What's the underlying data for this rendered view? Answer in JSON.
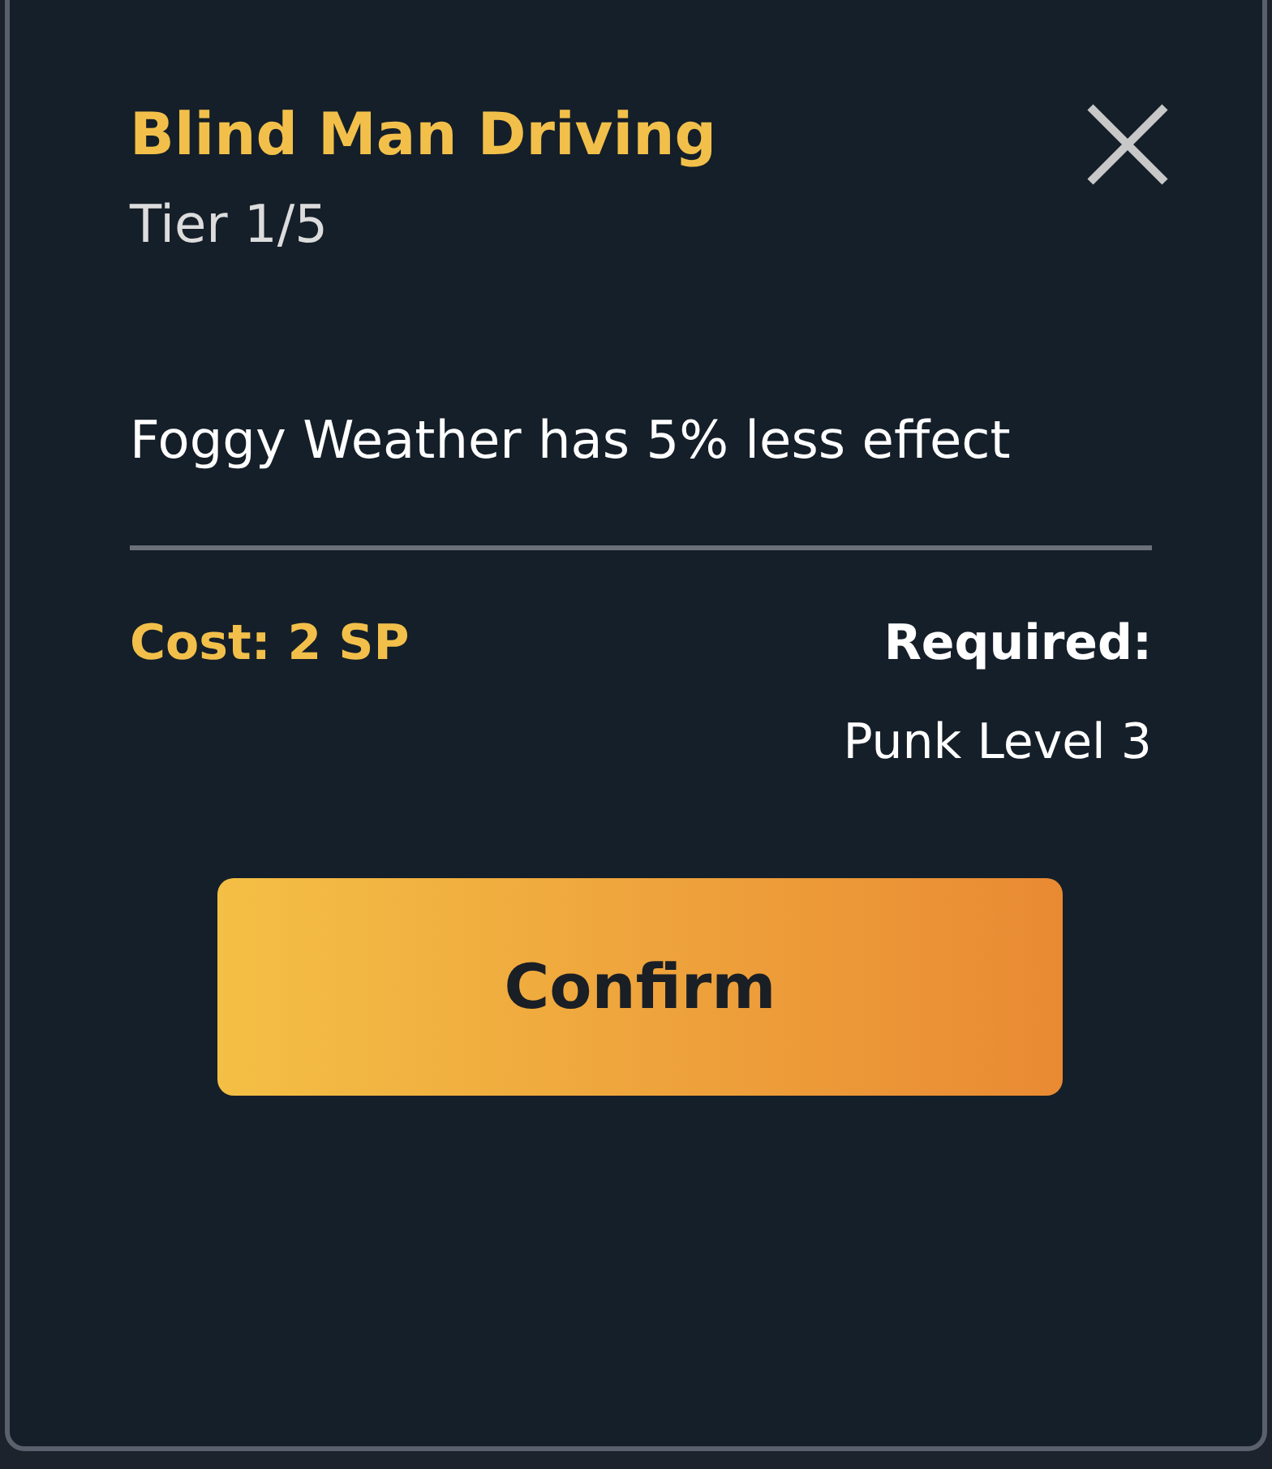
{
  "dialog": {
    "title": "Blind Man Driving",
    "tier": "Tier 1/5",
    "description": "Foggy Weather has 5% less effect",
    "cost": "Cost: 2 SP",
    "required_label": "Required:",
    "required_value": "Punk Level 3",
    "confirm_button": "Confirm"
  }
}
